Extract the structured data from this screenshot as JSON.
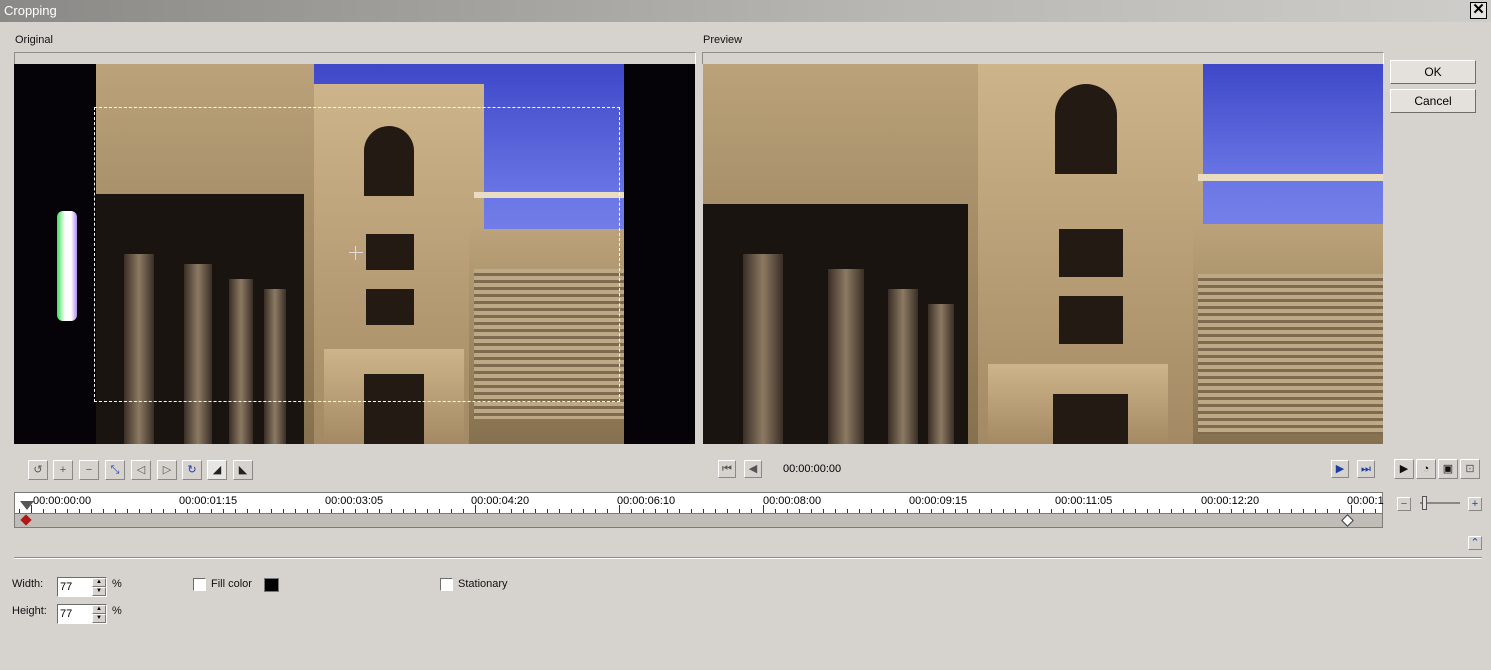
{
  "window": {
    "title": "Cropping",
    "close_glyph": "✕"
  },
  "panes": {
    "original_label": "Original",
    "preview_label": "Preview"
  },
  "buttons": {
    "ok": "OK",
    "cancel": "Cancel"
  },
  "preview_controls": {
    "timecode": "00:00:00:00"
  },
  "timeline": {
    "ticks": [
      "00:00:00:00",
      "00:00:01:15",
      "00:00:03:05",
      "00:00:04:20",
      "00:00:06:10",
      "00:00:08:00",
      "00:00:09:15",
      "00:00:11:05",
      "00:00:12:20",
      "00:00:1"
    ]
  },
  "settings": {
    "width_label": "Width:",
    "width_value": "77",
    "height_label": "Height:",
    "height_value": "77",
    "percent": "%",
    "fill_color_label": "Fill color",
    "fill_color_value": "#000000",
    "stationary_label": "Stationary"
  },
  "icons": {
    "crop_tools": [
      "reset-icon",
      "zoom-in-icon",
      "zoom-out-icon",
      "fit-icon",
      "prev-frame-icon",
      "next-frame-icon",
      "rotate-icon",
      "flip-left-icon",
      "flip-right-icon"
    ],
    "preview_nav": [
      "go-start-icon",
      "step-back-icon",
      "step-forward-icon",
      "go-end-icon"
    ],
    "playback": [
      "play-icon",
      "loop-icon",
      "preview-icon",
      "fullscreen-icon"
    ]
  }
}
